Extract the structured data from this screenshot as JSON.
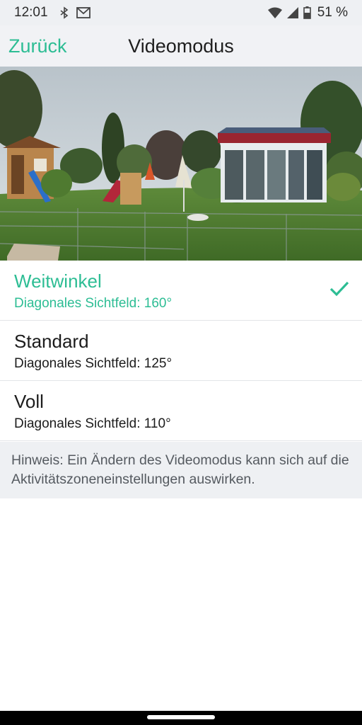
{
  "status_bar": {
    "time": "12:01",
    "battery_percent": "51 %",
    "icons": [
      "bluetooth-sync-icon",
      "gmail-icon",
      "wifi-icon",
      "signal-icon",
      "battery-icon"
    ]
  },
  "header": {
    "back_label": "Zurück",
    "title": "Videomodus"
  },
  "options": [
    {
      "title": "Weitwinkel",
      "subtitle": "Diagonales Sichtfeld: 160°",
      "selected": true
    },
    {
      "title": "Standard",
      "subtitle": "Diagonales Sichtfeld: 125°",
      "selected": false
    },
    {
      "title": "Voll",
      "subtitle": "Diagonales Sichtfeld: 110°",
      "selected": false
    }
  ],
  "hint": {
    "text": "Hinweis: Ein Ändern des Videomodus kann sich auf die Aktivitätszoneneinstellungen auswirken."
  },
  "colors": {
    "accent": "#2dbd94",
    "header_bg": "#f1f2f5",
    "hint_bg": "#eef0f3"
  }
}
